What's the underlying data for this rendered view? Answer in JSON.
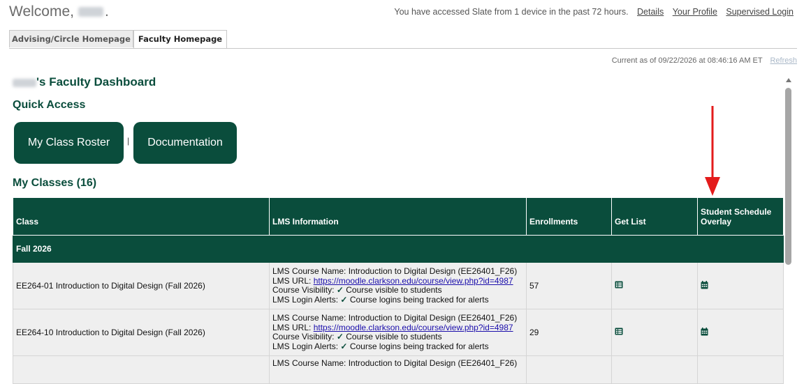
{
  "header": {
    "welcome": "Welcome,",
    "welcome_end": ".",
    "device_notice": "You have accessed Slate from 1 device in the past 72 hours.",
    "links": [
      "Details",
      "Your Profile",
      "Supervised Login"
    ]
  },
  "tabs": [
    {
      "label": "Advising/Circle Homepage",
      "active": false
    },
    {
      "label": "Faculty Homepage",
      "active": true
    }
  ],
  "status": {
    "as_of": "Current as of 09/22/2026 at 08:46:16 AM ET",
    "refresh": "Refresh"
  },
  "dashboard": {
    "title_suffix": "'s Faculty Dashboard",
    "quick_access": "Quick Access",
    "buttons": [
      "My Class Roster",
      "Documentation"
    ],
    "separator": "|",
    "classes_heading": "My Classes (16)"
  },
  "table": {
    "columns": [
      "Class",
      "LMS Information",
      "Enrollments",
      "Get List",
      "Student Schedule Overlay"
    ],
    "term": "Fall 2026",
    "rows": [
      {
        "class": "EE264-01 Introduction to Digital Design (Fall 2026)",
        "lms_course_label": "LMS Course Name:",
        "lms_course": "Introduction to Digital Design (EE26401_F26)",
        "lms_url_label": "LMS URL:",
        "lms_url": "https://moodle.clarkson.edu/course/view.php?id=4987",
        "visibility_label": "Course Visibility:",
        "visibility": "Course visible to students",
        "alerts_label": "LMS Login Alerts:",
        "alerts": "Course logins being tracked for alerts",
        "enrollments": "57"
      },
      {
        "class": "EE264-10 Introduction to Digital Design (Fall 2026)",
        "lms_course_label": "LMS Course Name:",
        "lms_course": "Introduction to Digital Design (EE26401_F26)",
        "lms_url_label": "LMS URL:",
        "lms_url": "https://moodle.clarkson.edu/course/view.php?id=4987",
        "visibility_label": "Course Visibility:",
        "visibility": "Course visible to students",
        "alerts_label": "LMS Login Alerts:",
        "alerts": "Course logins being tracked for alerts",
        "enrollments": "29"
      },
      {
        "lms_course_label": "LMS Course Name:",
        "lms_course": "Introduction to Digital Design (EE26401_F26)"
      }
    ]
  },
  "icons": {
    "get_list": "list-icon",
    "overlay": "calendar-icon",
    "check": "checkmark-icon"
  },
  "colors": {
    "brand_green": "#0a4d3c",
    "annotation_arrow": "#e31b1b"
  }
}
